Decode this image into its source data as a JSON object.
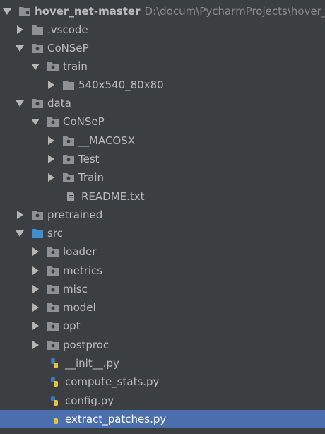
{
  "project": {
    "name": "hover_net-master",
    "path": "D:\\docum\\PycharmProjects\\hover_ne"
  },
  "nodes": [
    {
      "label": ".vscode",
      "icon": "folder-icon",
      "expanded": false
    },
    {
      "label": "CoNSeP",
      "icon": "folder-icon",
      "expanded": true
    },
    {
      "label": "train",
      "icon": "folder-icon",
      "expanded": true
    },
    {
      "label": "540x540_80x80",
      "icon": "folder-icon",
      "expanded": false
    },
    {
      "label": "data",
      "icon": "folder-icon",
      "expanded": true
    },
    {
      "label": "CoNSeP",
      "icon": "folder-icon",
      "expanded": true
    },
    {
      "label": "__MACOSX",
      "icon": "folder-icon",
      "expanded": false
    },
    {
      "label": "Test",
      "icon": "folder-icon",
      "expanded": false
    },
    {
      "label": "Train",
      "icon": "folder-icon",
      "expanded": false
    },
    {
      "label": "README.txt",
      "icon": "text-file-icon"
    },
    {
      "label": "pretrained",
      "icon": "folder-icon",
      "expanded": false
    },
    {
      "label": "src",
      "icon": "source-folder-icon",
      "expanded": true
    },
    {
      "label": "loader",
      "icon": "folder-icon",
      "expanded": false
    },
    {
      "label": "metrics",
      "icon": "folder-icon",
      "expanded": false
    },
    {
      "label": "misc",
      "icon": "folder-icon",
      "expanded": false
    },
    {
      "label": "model",
      "icon": "folder-icon",
      "expanded": false
    },
    {
      "label": "opt",
      "icon": "folder-icon",
      "expanded": false
    },
    {
      "label": "postproc",
      "icon": "folder-icon",
      "expanded": false
    },
    {
      "label": "__init__.py",
      "icon": "python-file-icon"
    },
    {
      "label": "compute_stats.py",
      "icon": "python-file-icon"
    },
    {
      "label": "config.py",
      "icon": "python-file-icon"
    },
    {
      "label": "extract_patches.py",
      "icon": "python-file-icon",
      "selected": true
    }
  ],
  "colors": {
    "background": "#3c3f41",
    "selection": "#4b6eaf",
    "text": "#bbbbbb",
    "folder": "#8c9196",
    "source_folder": "#3d8fd1"
  }
}
